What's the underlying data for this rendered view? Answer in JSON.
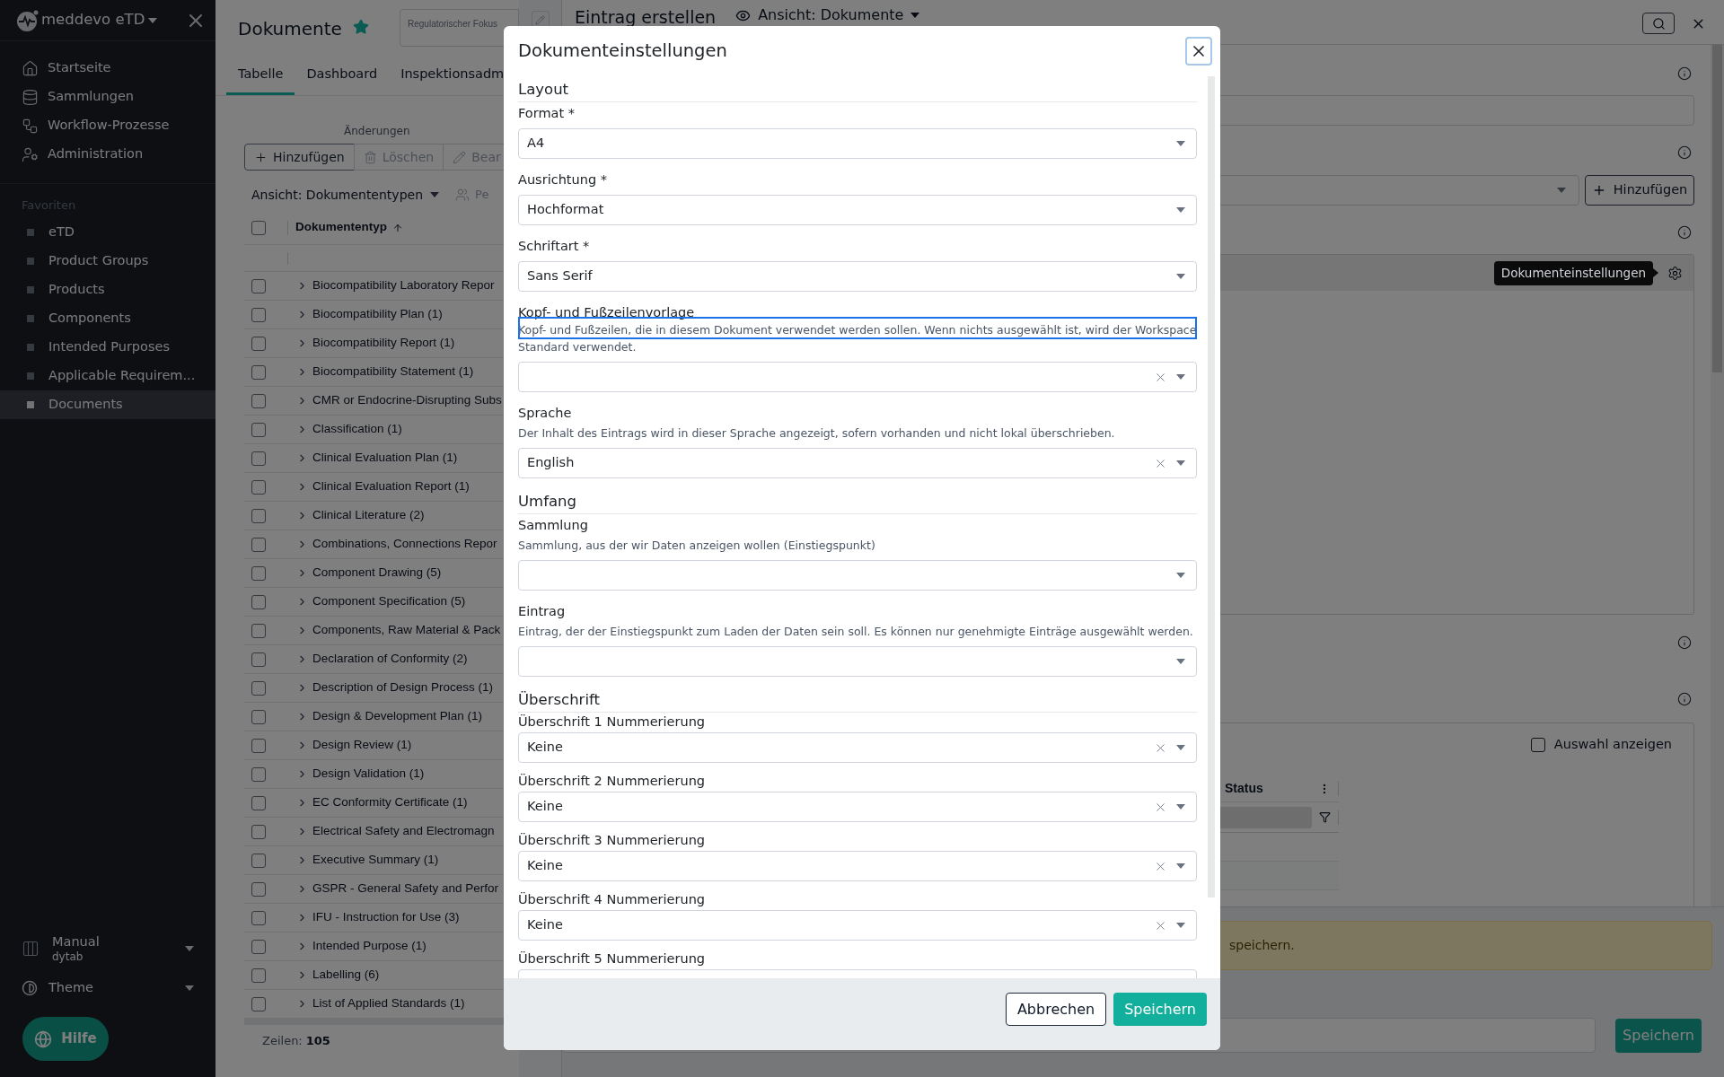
{
  "sidebar": {
    "brand": "meddevo eTD",
    "nav": [
      {
        "label": "Startseite"
      },
      {
        "label": "Sammlungen"
      },
      {
        "label": "Workflow-Prozesse"
      },
      {
        "label": "Administration"
      }
    ],
    "favorites_title": "Favoriten",
    "favorites": [
      {
        "label": "eTD",
        "selected": false
      },
      {
        "label": "Product Groups",
        "selected": false
      },
      {
        "label": "Products",
        "selected": false
      },
      {
        "label": "Components",
        "selected": false
      },
      {
        "label": "Intended Purposes",
        "selected": false
      },
      {
        "label": "Applicable Requirem...",
        "selected": false
      },
      {
        "label": "Documents",
        "selected": true
      }
    ],
    "workspace": {
      "name": "Manual",
      "org": "dytab"
    },
    "theme": "Theme",
    "help": "Hilfe"
  },
  "documents": {
    "title": "Dokumente",
    "starred": true,
    "focus_field": {
      "label": "Regulatorischer Fokus"
    },
    "tabs": [
      {
        "label": "Tabelle",
        "selected": true
      },
      {
        "label": "Dashboard",
        "selected": false
      },
      {
        "label": "Inspektionsadm",
        "selected": false
      }
    ],
    "toolbar": {
      "group_label": "Änderungen",
      "buttons": [
        {
          "label": "Hinzufügen",
          "disabled": false
        },
        {
          "label": "Löschen",
          "disabled": true
        },
        {
          "label": "Bear",
          "disabled": true
        }
      ]
    },
    "view": "Ansicht: Dokumententypen",
    "people_button": "Pe",
    "table": {
      "all_checked": false,
      "column": "Dokumententyp",
      "rows": [
        {
          "label": "Biocompatibility Laboratory Repor",
          "checked": false
        },
        {
          "label": "Biocompatibility Plan (1)",
          "checked": false
        },
        {
          "label": "Biocompatibility Report (1)",
          "checked": false
        },
        {
          "label": "Biocompatibility Statement (1)",
          "checked": false
        },
        {
          "label": "CMR or Endocrine-Disrupting Subs",
          "checked": false
        },
        {
          "label": "Classification (1)",
          "checked": false
        },
        {
          "label": "Clinical Evaluation Plan (1)",
          "checked": false
        },
        {
          "label": "Clinical Evaluation Report (1)",
          "checked": false
        },
        {
          "label": "Clinical Literature (2)",
          "checked": false
        },
        {
          "label": "Combinations, Connections Repor",
          "checked": false
        },
        {
          "label": "Component Drawing (5)",
          "checked": false
        },
        {
          "label": "Component Specification (5)",
          "checked": false
        },
        {
          "label": "Components, Raw Material & Pack",
          "checked": false
        },
        {
          "label": "Declaration of Conformity (2)",
          "checked": false
        },
        {
          "label": "Description of Design Process (1)",
          "checked": false
        },
        {
          "label": "Design & Development Plan (1)",
          "checked": false
        },
        {
          "label": "Design Review (1)",
          "checked": false
        },
        {
          "label": "Design Validation (1)",
          "checked": false
        },
        {
          "label": "EC Conformity Certificate (1)",
          "checked": false
        },
        {
          "label": "Electrical Safety and Electromagn",
          "checked": false
        },
        {
          "label": "Executive Summary (1)",
          "checked": false
        },
        {
          "label": "GSPR - General Safety and Perfor",
          "checked": false
        },
        {
          "label": "IFU - Instruction for Use (3)",
          "checked": false
        },
        {
          "label": "Intended Purpose (1)",
          "checked": false
        },
        {
          "label": "Labelling (6)",
          "checked": false
        },
        {
          "label": "List of Applied Standards (1)",
          "checked": false
        }
      ]
    },
    "footer": {
      "label": "Zeilen:",
      "count": "105"
    }
  },
  "entry": {
    "title": "Eintrag erstellen",
    "view": "Ansicht: Dokumente",
    "add_button": "Hinzufügen",
    "tooltip": "Dokumenteinstellungen",
    "selection_toggle": {
      "label": "Auswahl anzeigen",
      "checked": false
    },
    "status_column": "Status",
    "alert": "speichern.",
    "save_button": "Speichern"
  },
  "modal": {
    "title": "Dokumenteinstellungen",
    "sections": [
      {
        "heading": "Layout",
        "fields": [
          {
            "label": "Format *",
            "value": "A4",
            "clearable": false,
            "highlighted": false
          },
          {
            "label": "Ausrichtung *",
            "value": "Hochformat",
            "clearable": false,
            "highlighted": false
          },
          {
            "label": "Schriftart *",
            "value": "Sans Serif",
            "clearable": false,
            "highlighted": false
          },
          {
            "label": "Kopf- und Fußzeilenvorlage",
            "description": "Kopf- und Fußzeilen, die in diesem Dokument verwendet werden sollen. Wenn nichts ausgewählt ist, wird der Workspace Standard verwendet.",
            "clearable": true,
            "highlighted": true
          },
          {
            "label": "Sprache",
            "description": "Der Inhalt des Eintrags wird in dieser Sprache angezeigt, sofern vorhanden und nicht lokal überschrieben.",
            "value": "English",
            "clearable": true,
            "highlighted": false
          }
        ]
      },
      {
        "heading": "Umfang",
        "fields": [
          {
            "label": "Sammlung",
            "description": "Sammlung, aus der wir Daten anzeigen wollen (Einstiegspunkt)",
            "clearable": false,
            "highlighted": false
          },
          {
            "label": "Eintrag",
            "description": "Eintrag, der der Einstiegspunkt zum Laden der Daten sein soll. Es können nur genehmigte Einträge ausgewählt werden.",
            "clearable": false,
            "highlighted": false
          }
        ]
      },
      {
        "heading": "Überschrift",
        "fields": [
          {
            "label": "Überschrift 1 Nummerierung",
            "value": "Keine",
            "clearable": true,
            "highlighted": false
          },
          {
            "label": "Überschrift 2 Nummerierung",
            "value": "Keine",
            "clearable": true,
            "highlighted": false
          },
          {
            "label": "Überschrift 3 Nummerierung",
            "value": "Keine",
            "clearable": true,
            "highlighted": false
          },
          {
            "label": "Überschrift 4 Nummerierung",
            "value": "Keine",
            "clearable": true,
            "highlighted": false
          },
          {
            "label": "Überschrift 5 Nummerierung",
            "clearable": false,
            "highlighted": false
          }
        ]
      }
    ],
    "buttons": [
      {
        "label": "Abbrechen",
        "kind": "secondary"
      },
      {
        "label": "Speichern",
        "kind": "primary"
      }
    ]
  }
}
